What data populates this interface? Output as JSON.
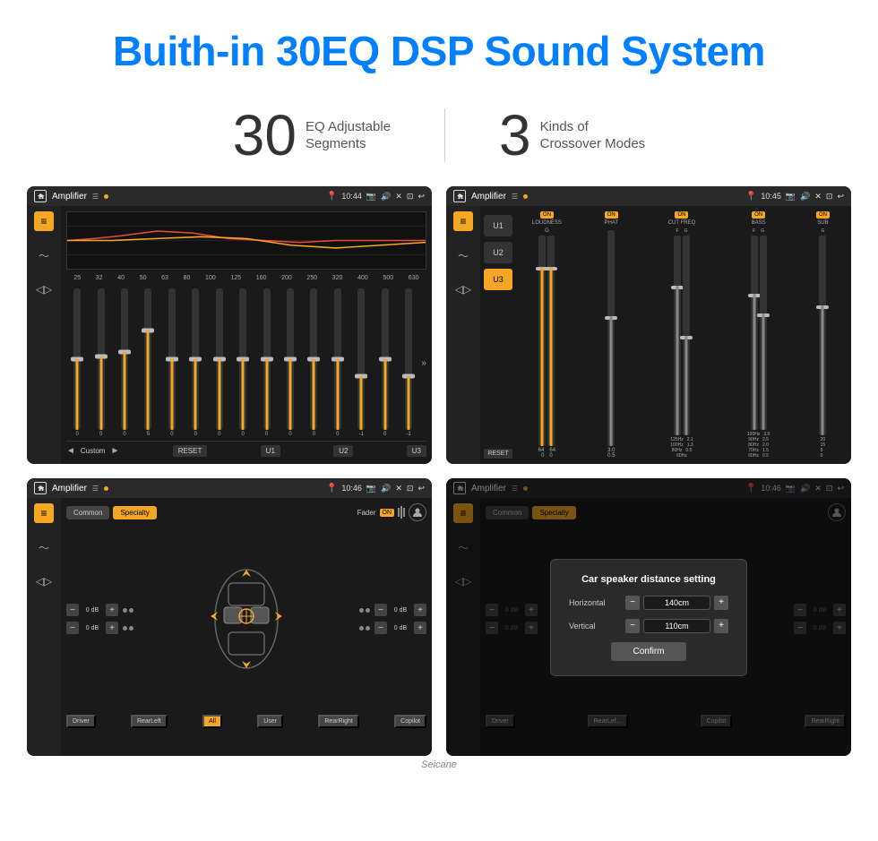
{
  "header": {
    "title": "Buith-in 30EQ DSP Sound System"
  },
  "stats": [
    {
      "number": "30",
      "desc_line1": "EQ Adjustable",
      "desc_line2": "Segments"
    },
    {
      "number": "3",
      "desc_line1": "Kinds of",
      "desc_line2": "Crossover Modes"
    }
  ],
  "screens": [
    {
      "id": "screen1",
      "title": "Amplifier",
      "time": "10:44",
      "eq_labels": [
        "25",
        "32",
        "40",
        "50",
        "63",
        "80",
        "100",
        "125",
        "160",
        "200",
        "250",
        "320",
        "400",
        "500",
        "630"
      ],
      "eq_values": [
        "0",
        "0",
        "0",
        "5",
        "0",
        "0",
        "0",
        "0",
        "0",
        "0",
        "0",
        "0",
        "-1",
        "0",
        "-1"
      ],
      "eq_heights": [
        50,
        50,
        50,
        65,
        50,
        50,
        50,
        50,
        50,
        50,
        50,
        50,
        38,
        50,
        38
      ],
      "bottom_btns": [
        "Custom",
        "RESET",
        "U1",
        "U2",
        "U3"
      ]
    },
    {
      "id": "screen2",
      "title": "Amplifier",
      "time": "10:45",
      "u_btns": [
        "U1",
        "U2",
        "U3"
      ],
      "active_u": "U3",
      "channels": [
        {
          "label": "LOUDNESS",
          "on": true
        },
        {
          "label": "PHAT",
          "on": true
        },
        {
          "label": "CUT FREQ",
          "on": true
        },
        {
          "label": "BASS",
          "on": true
        },
        {
          "label": "SUB",
          "on": true
        }
      ],
      "reset_label": "RESET"
    },
    {
      "id": "screen3",
      "title": "Amplifier",
      "time": "10:46",
      "tab_common": "Common",
      "tab_specialty": "Specialty",
      "fader_label": "Fader",
      "on_label": "ON",
      "positions": {
        "driver": "Driver",
        "rearLeft": "RearLeft",
        "all": "All",
        "user": "User",
        "rearRight": "RearRight",
        "copilot": "Copilot"
      },
      "controls": [
        {
          "label": "0 dB"
        },
        {
          "label": "0 dB"
        },
        {
          "label": "0 dB"
        },
        {
          "label": "0 dB"
        }
      ]
    },
    {
      "id": "screen4",
      "title": "Amplifier",
      "time": "10:46",
      "dialog": {
        "title": "Car speaker distance setting",
        "horizontal_label": "Horizontal",
        "horizontal_value": "140cm",
        "vertical_label": "Vertical",
        "vertical_value": "110cm",
        "confirm_label": "Confirm"
      },
      "tab_common": "Common",
      "tab_specialty": "Specialty",
      "positions": {
        "driver": "Driver",
        "rearLeft": "RearLef...",
        "copilot": "Copilot",
        "rearRight": "RearRight"
      }
    }
  ],
  "watermark": "Seicane"
}
